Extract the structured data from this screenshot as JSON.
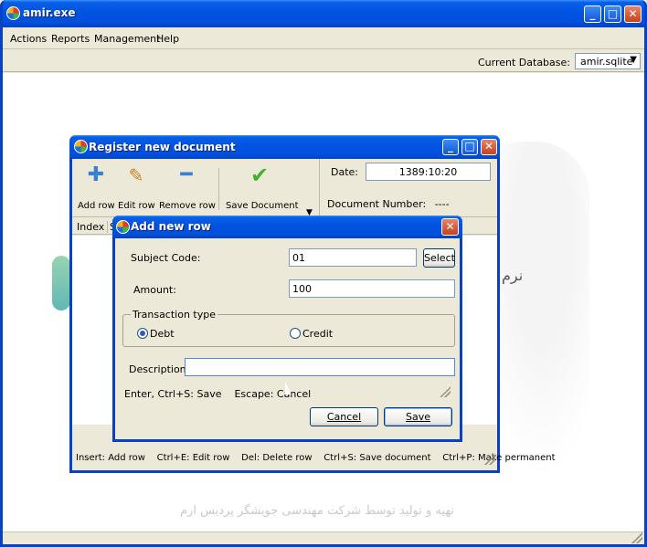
{
  "app": {
    "title": "amir.exe",
    "menu": [
      "Actions",
      "Reports",
      "Management",
      "Help"
    ],
    "db_label": "Current Database:",
    "db_value": "amir.sqlite",
    "brand_text": "تهیه و تولید توسط شرکت مهندسی جویشگر پردیس ارم",
    "brand_word": "نرم"
  },
  "register": {
    "title": "Register new document",
    "toolbar": {
      "add_row": "Add row",
      "edit_row": "Edit row",
      "remove_row": "Remove row",
      "save_document": "Save Document"
    },
    "date_label": "Date:",
    "date_value": "1389:10:20",
    "doc_number_label": "Document Number:",
    "doc_number_value": "----",
    "columns": [
      "Index",
      "S"
    ],
    "shortcuts": "Insert: Add row    Ctrl+E: Edit row    Del: Delete row    Ctrl+S: Save document    Ctrl+P: Make permanent"
  },
  "dialog": {
    "title": "Add new row",
    "subject_code_label": "Subject Code:",
    "subject_code_value": "01",
    "select_label": "Select",
    "amount_label": "Amount:",
    "amount_value": "100",
    "transaction_type_label": "Transaction type",
    "debt_label": "Debt",
    "credit_label": "Credit",
    "description_label": "Description:",
    "description_value": "",
    "hint": "Enter, Ctrl+S: Save    Escape: Cancel",
    "cancel_label": "Cancel",
    "save_label": "Save"
  },
  "colors": {
    "titlebar_blue": "#0053e1",
    "window_bg": "#ece9d8",
    "close_red": "#c6421a"
  }
}
